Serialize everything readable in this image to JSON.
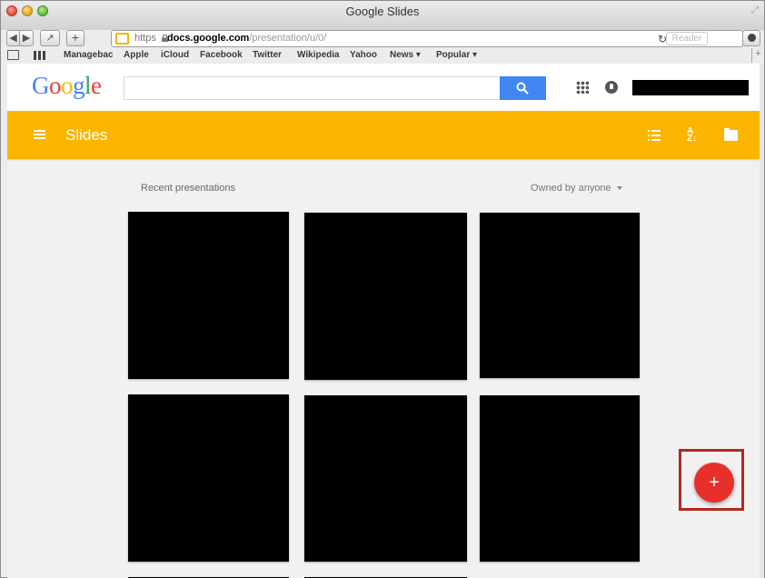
{
  "window": {
    "title": "Google Slides"
  },
  "toolbar": {
    "back_icon": "back-arrow-icon",
    "forward_icon": "forward-arrow-icon",
    "share_icon": "share-icon",
    "new_tab_label": "+",
    "url_scheme": "https",
    "url_host": "docs.google.com",
    "url_path": "/presentation/u/0/",
    "reload_label": "↻",
    "reader_label": "Reader"
  },
  "bookmarks": [
    "Managebac",
    "Apple",
    "iCloud",
    "Facebook",
    "Twitter",
    "Wikipedia",
    "Yahoo",
    "News ▾",
    "Popular ▾"
  ],
  "google": {
    "logo_letters": [
      {
        "ch": "G",
        "color": "#4285f4"
      },
      {
        "ch": "o",
        "color": "#ea4335"
      },
      {
        "ch": "o",
        "color": "#fbbc05"
      },
      {
        "ch": "g",
        "color": "#4285f4"
      },
      {
        "ch": "l",
        "color": "#34a853"
      },
      {
        "ch": "e",
        "color": "#ea4335"
      }
    ],
    "search_value": ""
  },
  "appbar": {
    "title": "Slides",
    "color": "#fbb500"
  },
  "content": {
    "section_title": "Recent presentations",
    "owner_filter": "Owned by anyone"
  },
  "fab": {
    "label": "+",
    "color": "#e8302a"
  }
}
